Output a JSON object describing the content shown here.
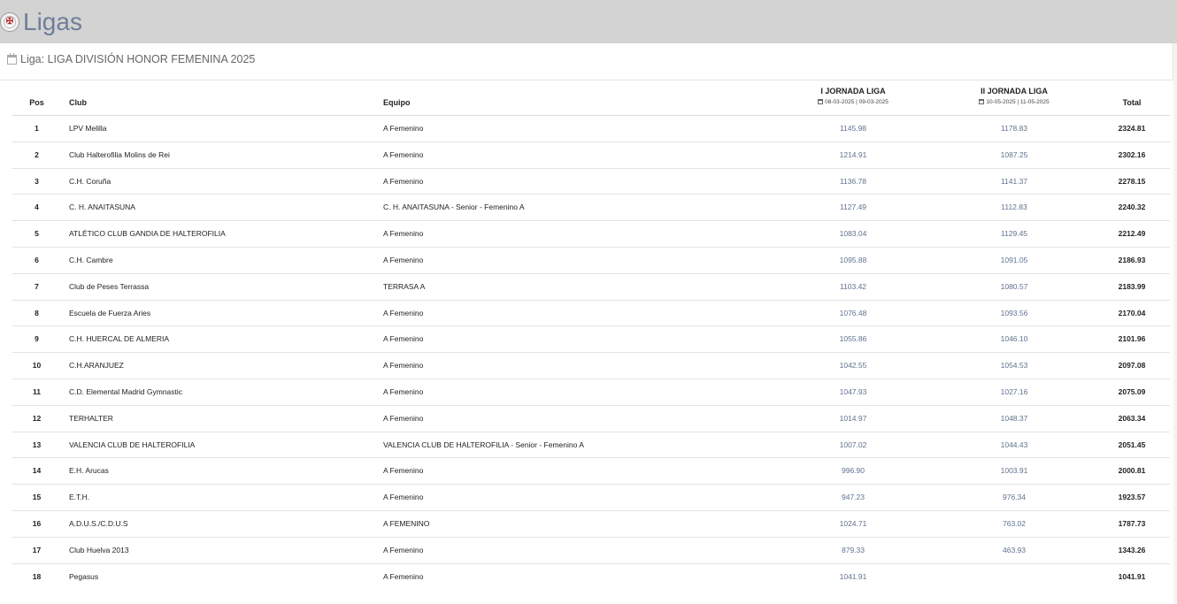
{
  "header": {
    "title": "Ligas",
    "logo_icon": "federation-logo-icon"
  },
  "liga": {
    "label": "Liga: LIGA DIVISIÓN HONOR FEMENINA 2025",
    "icon": "calendar-icon"
  },
  "table": {
    "columns": {
      "pos": "Pos",
      "club": "Club",
      "team": "Equipo",
      "j1": "I JORNADA LIGA",
      "j1_dates": "08-03-2025 | 09-03-2025",
      "j2": "II JORNADA LIGA",
      "j2_dates": "10-05-2025 | 11-05-2025",
      "total": "Total"
    },
    "rows": [
      {
        "pos": "1",
        "club": "LPV Melilla",
        "team": "A Femenino",
        "j1": "1145.98",
        "j2": "1178.83",
        "total": "2324.81"
      },
      {
        "pos": "2",
        "club": "Club Halterofilia Molins de Rei",
        "team": "A Femenino",
        "j1": "1214.91",
        "j2": "1087.25",
        "total": "2302.16"
      },
      {
        "pos": "3",
        "club": "C.H. Coruña",
        "team": "A Femenino",
        "j1": "1136.78",
        "j2": "1141.37",
        "total": "2278.15"
      },
      {
        "pos": "4",
        "club": "C. H. ANAITASUNA",
        "team": "C. H. ANAITASUNA - Senior - Femenino A",
        "j1": "1127.49",
        "j2": "1112.83",
        "total": "2240.32"
      },
      {
        "pos": "5",
        "club": "ATLÉTICO CLUB GANDIA DE HALTEROFILIA",
        "team": "A Femenino",
        "j1": "1083.04",
        "j2": "1129.45",
        "total": "2212.49"
      },
      {
        "pos": "6",
        "club": "C.H. Cambre",
        "team": "A Femenino",
        "j1": "1095.88",
        "j2": "1091.05",
        "total": "2186.93"
      },
      {
        "pos": "7",
        "club": "Club de Peses Terrassa",
        "team": "TERRASA A",
        "j1": "1103.42",
        "j2": "1080.57",
        "total": "2183.99"
      },
      {
        "pos": "8",
        "club": "Escuela de Fuerza Aries",
        "team": "A Femenino",
        "j1": "1076.48",
        "j2": "1093.56",
        "total": "2170.04"
      },
      {
        "pos": "9",
        "club": "C.H. HUERCAL DE ALMERIA",
        "team": "A Femenino",
        "j1": "1055.86",
        "j2": "1046.10",
        "total": "2101.96"
      },
      {
        "pos": "10",
        "club": "C.H.ARANJUEZ",
        "team": "A Femenino",
        "j1": "1042.55",
        "j2": "1054.53",
        "total": "2097.08"
      },
      {
        "pos": "11",
        "club": "C.D. Elemental Madrid Gymnastic",
        "team": "A Femenino",
        "j1": "1047.93",
        "j2": "1027.16",
        "total": "2075.09"
      },
      {
        "pos": "12",
        "club": "TERHALTER",
        "team": "A Femenino",
        "j1": "1014.97",
        "j2": "1048.37",
        "total": "2063.34"
      },
      {
        "pos": "13",
        "club": "VALENCIA CLUB DE HALTEROFILIA",
        "team": "VALENCIA CLUB DE HALTEROFILIA - Senior - Femenino A",
        "j1": "1007.02",
        "j2": "1044.43",
        "total": "2051.45"
      },
      {
        "pos": "14",
        "club": "E.H. Arucas",
        "team": "A Femenino",
        "j1": "996.90",
        "j2": "1003.91",
        "total": "2000.81"
      },
      {
        "pos": "15",
        "club": "E.T.H.",
        "team": "A Femenino",
        "j1": "947.23",
        "j2": "976.34",
        "total": "1923.57"
      },
      {
        "pos": "16",
        "club": "A.D.U.S./C.D.U.S",
        "team": "A FEMENINO",
        "j1": "1024.71",
        "j2": "763.02",
        "total": "1787.73"
      },
      {
        "pos": "17",
        "club": "Club Huelva 2013",
        "team": "A Femenino",
        "j1": "879.33",
        "j2": "463.93",
        "total": "1343.26"
      },
      {
        "pos": "18",
        "club": "Pegasus",
        "team": "A Femenino",
        "j1": "1041.91",
        "j2": "",
        "total": "1041.91"
      }
    ]
  }
}
